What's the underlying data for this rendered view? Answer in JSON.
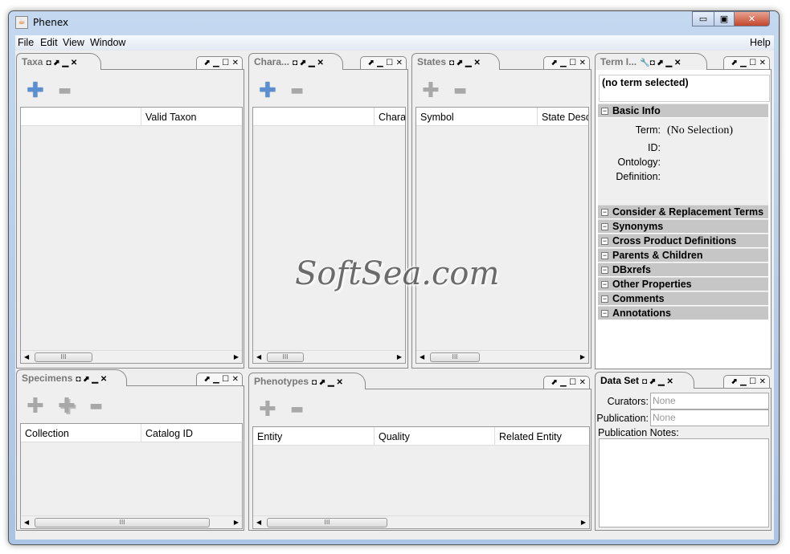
{
  "window": {
    "title": "Phenex",
    "minimize": "▭",
    "restore": "▣",
    "close": "✕"
  },
  "menu": {
    "items": [
      "File",
      "Edit",
      "View",
      "Window"
    ],
    "help": "Help"
  },
  "panel_controls": "⬈ ▁ ☐ ✕",
  "panels": {
    "taxa": {
      "title": "Taxa",
      "tab_icons": "◘ ⬈ ▁ ✕",
      "columns": [
        "",
        "Valid Taxon"
      ]
    },
    "characters": {
      "title": "Chara...",
      "tab_icons": "◘ ⬈ ▁ ✕",
      "columns": [
        "",
        "Chara"
      ]
    },
    "states": {
      "title": "States",
      "tab_icons": "◘ ⬈ ▁ ✕",
      "columns": [
        "Symbol",
        "State Desc"
      ]
    },
    "term_info": {
      "title": "Term I...",
      "tab_icons": "🔧◘ ⬈ ▁ ✕",
      "selected": "(no term selected)",
      "basic_info": "Basic Info",
      "term_label": "Term:",
      "term_value": "(No Selection)",
      "id_label": "ID:",
      "ontology_label": "Ontology:",
      "definition_label": "Definition:",
      "sections": [
        "Consider & Replacement Terms",
        "Synonyms",
        "Cross Product Definitions",
        "Parents & Children",
        "DBxrefs",
        "Other Properties",
        "Comments",
        "Annotations"
      ]
    },
    "specimens": {
      "title": "Specimens",
      "tab_icons": "◘ ⬈ ▁ ✕",
      "columns": [
        "Collection",
        "Catalog ID"
      ]
    },
    "phenotypes": {
      "title": "Phenotypes",
      "tab_icons": "◘ ⬈ ▁ ✕",
      "columns": [
        "Entity",
        "Quality",
        "Related Entity"
      ]
    },
    "data_set": {
      "title": "Data Set",
      "tab_icons": "◘ ⬈ ▁ ✕",
      "curators_label": "Curators:",
      "curators_placeholder": "None",
      "publication_label": "Publication:",
      "publication_placeholder": "None",
      "notes_label": "Publication Notes:"
    }
  },
  "buttons": {
    "add": "✚",
    "remove": "▬",
    "add_multiple": "✚"
  },
  "scroll": {
    "grip": "III",
    "left": "◀",
    "right": "▶"
  },
  "watermark": "SoftSea.com"
}
